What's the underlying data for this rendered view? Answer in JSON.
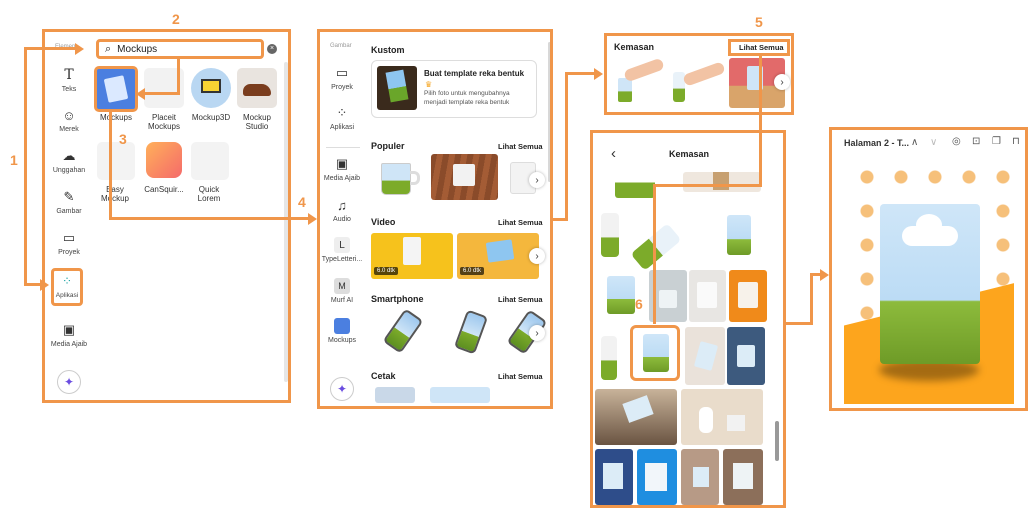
{
  "steps": [
    "1",
    "2",
    "3",
    "4",
    "5",
    "6"
  ],
  "panel1": {
    "rail_label_top": "Elemen",
    "rail": [
      {
        "label": "Teks",
        "icon": "text-icon"
      },
      {
        "label": "Merek",
        "icon": "brand-icon"
      },
      {
        "label": "Unggahan",
        "icon": "upload-icon"
      },
      {
        "label": "Gambar",
        "icon": "draw-icon"
      },
      {
        "label": "Proyek",
        "icon": "folder-icon"
      },
      {
        "label": "Aplikasi",
        "icon": "apps-icon"
      },
      {
        "label": "Media Ajaib",
        "icon": "magic-media-icon"
      }
    ],
    "search_value": "Mockups",
    "apps": [
      {
        "label": "Mockups"
      },
      {
        "label": "Placeit\nMockups"
      },
      {
        "label": "Mockup3D"
      },
      {
        "label": "Mockup\nStudio"
      },
      {
        "label": "Easy\nMockup"
      },
      {
        "label": "CanSquir..."
      },
      {
        "label": "Quick\nLorem"
      }
    ]
  },
  "panel2": {
    "rail_label_top": "Gambar",
    "rail": [
      {
        "label": "Proyek",
        "icon": "folder-icon"
      },
      {
        "label": "Aplikasi",
        "icon": "apps-icon"
      },
      {
        "label": "Media Ajaib",
        "icon": "magic-media-icon"
      },
      {
        "label": "Audio",
        "icon": "music-icon"
      },
      {
        "label": "TypeLetteri...",
        "icon": "typelettering-icon"
      },
      {
        "label": "Murf AI",
        "icon": "murf-icon"
      },
      {
        "label": "Mockups",
        "icon": "mockups-icon"
      }
    ],
    "kustom_title": "Kustom",
    "kustom_card_title": "Buat template reka bentuk",
    "kustom_card_desc": "Pilih foto untuk mengubahnya menjadi template reka bentuk",
    "sections": [
      {
        "title": "Populer",
        "see_all": "Lihat Semua"
      },
      {
        "title": "Video",
        "see_all": "Lihat Semua"
      },
      {
        "title": "Smartphone",
        "see_all": "Lihat Semua"
      },
      {
        "title": "Cetak",
        "see_all": "Lihat Semua"
      }
    ],
    "video_badges": [
      "6.0 dtk",
      "6.0 dtk"
    ]
  },
  "panel3": {
    "title": "Kemasan",
    "see_all": "Lihat Semua"
  },
  "panel4": {
    "title": "Kemasan",
    "back": "‹"
  },
  "panel5": {
    "page_title": "Halaman 2 - T..."
  }
}
